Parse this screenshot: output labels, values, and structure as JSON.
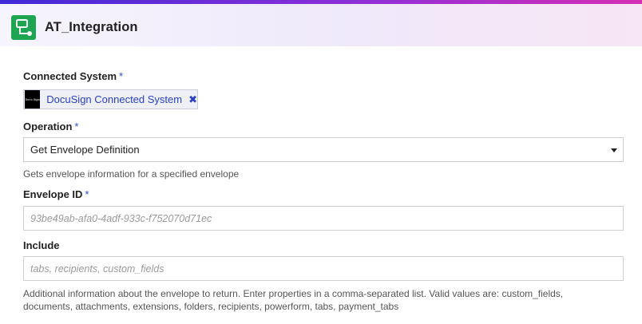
{
  "header": {
    "title": "AT_Integration",
    "icon": "integration-icon",
    "accent_colors": [
      "#3f2ad6",
      "#8d2fd8",
      "#d62fb4"
    ],
    "icon_color": "#1ea552"
  },
  "form": {
    "connected_system": {
      "label": "Connected System",
      "required_mark": "*",
      "chip_label": "DocuSign Connected System",
      "chip_logo_text": "Docu Sign",
      "remove_icon": "close-icon"
    },
    "operation": {
      "label": "Operation",
      "required_mark": "*",
      "selected": "Get Envelope Definition",
      "help": "Gets envelope information for a specified envelope"
    },
    "envelope_id": {
      "label": "Envelope ID",
      "required_mark": "*",
      "placeholder": "93be49ab-afa0-4adf-933c-f752070d71ec",
      "value": ""
    },
    "include": {
      "label": "Include",
      "placeholder": "tabs, recipients, custom_fields",
      "value": "",
      "help_line1": "Additional information about the envelope to return. Enter properties in a comma-separated list. Valid values are: custom_fields,",
      "help_line2": "documents, attachments, extensions, folders, recipients, powerform, tabs, payment_tabs"
    }
  }
}
